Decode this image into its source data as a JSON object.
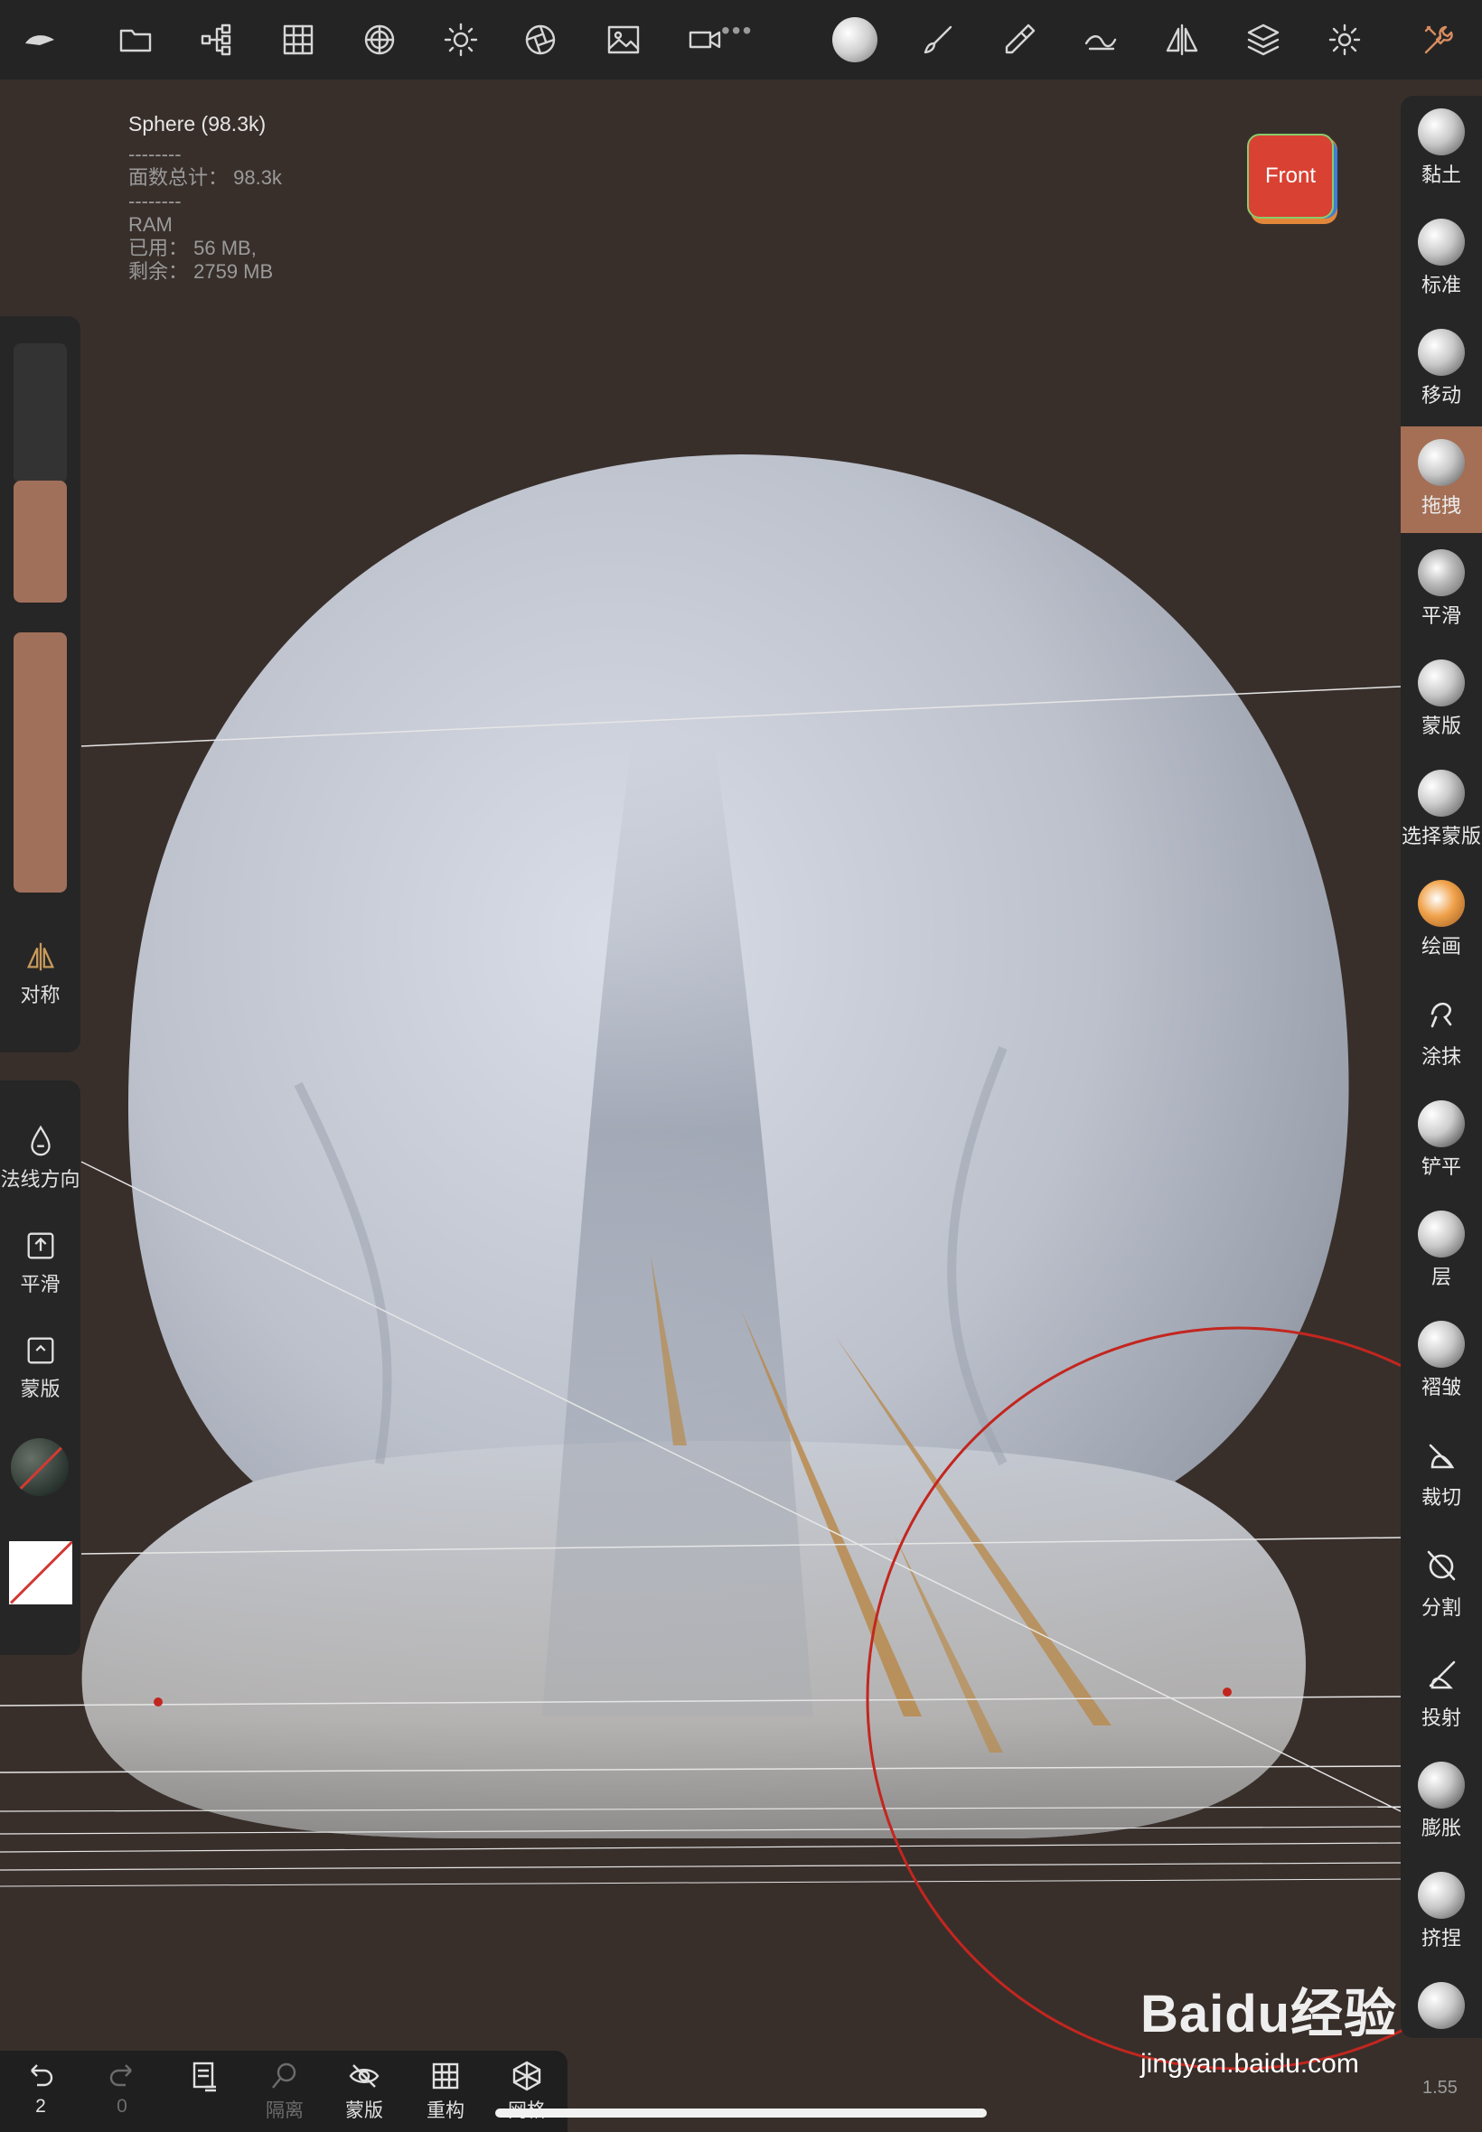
{
  "info": {
    "title": "Sphere (98.3k)",
    "sep1": "--------",
    "faces": "面数总计： 98.3k",
    "sep2": "--------",
    "ram": "RAM",
    "used": "已用： 56 MB,",
    "free": "剩余： 2759 MB"
  },
  "gizmo": {
    "label": "Front",
    "color": "#d94133"
  },
  "left_panel": {
    "symmetry": "对称",
    "normal": "法线方向",
    "smooth": "平滑",
    "mask": "蒙版"
  },
  "tools": [
    {
      "label": "黏土"
    },
    {
      "label": "标准"
    },
    {
      "label": "移动"
    },
    {
      "label": "拖拽"
    },
    {
      "label": "平滑"
    },
    {
      "label": "蒙版"
    },
    {
      "label": "选择蒙版"
    },
    {
      "label": "绘画"
    },
    {
      "label": "涂抹"
    },
    {
      "label": "铲平"
    },
    {
      "label": "层"
    },
    {
      "label": "褶皱"
    },
    {
      "label": "裁切"
    },
    {
      "label": "分割"
    },
    {
      "label": "投射"
    },
    {
      "label": "膨胀"
    },
    {
      "label": "挤捏"
    }
  ],
  "bottom": {
    "undo_count": "2",
    "redo_count": "0",
    "isolate": "隔离",
    "mask": "蒙版",
    "remesh": "重构",
    "wire": "网格"
  },
  "zoom": "1.55",
  "watermark": {
    "logo": "Baidu经验",
    "url": "jingyan.baidu.com"
  },
  "colors": {
    "accent": "#a46f55",
    "background": "#382f2b",
    "brush_ring": "#c3261f"
  }
}
